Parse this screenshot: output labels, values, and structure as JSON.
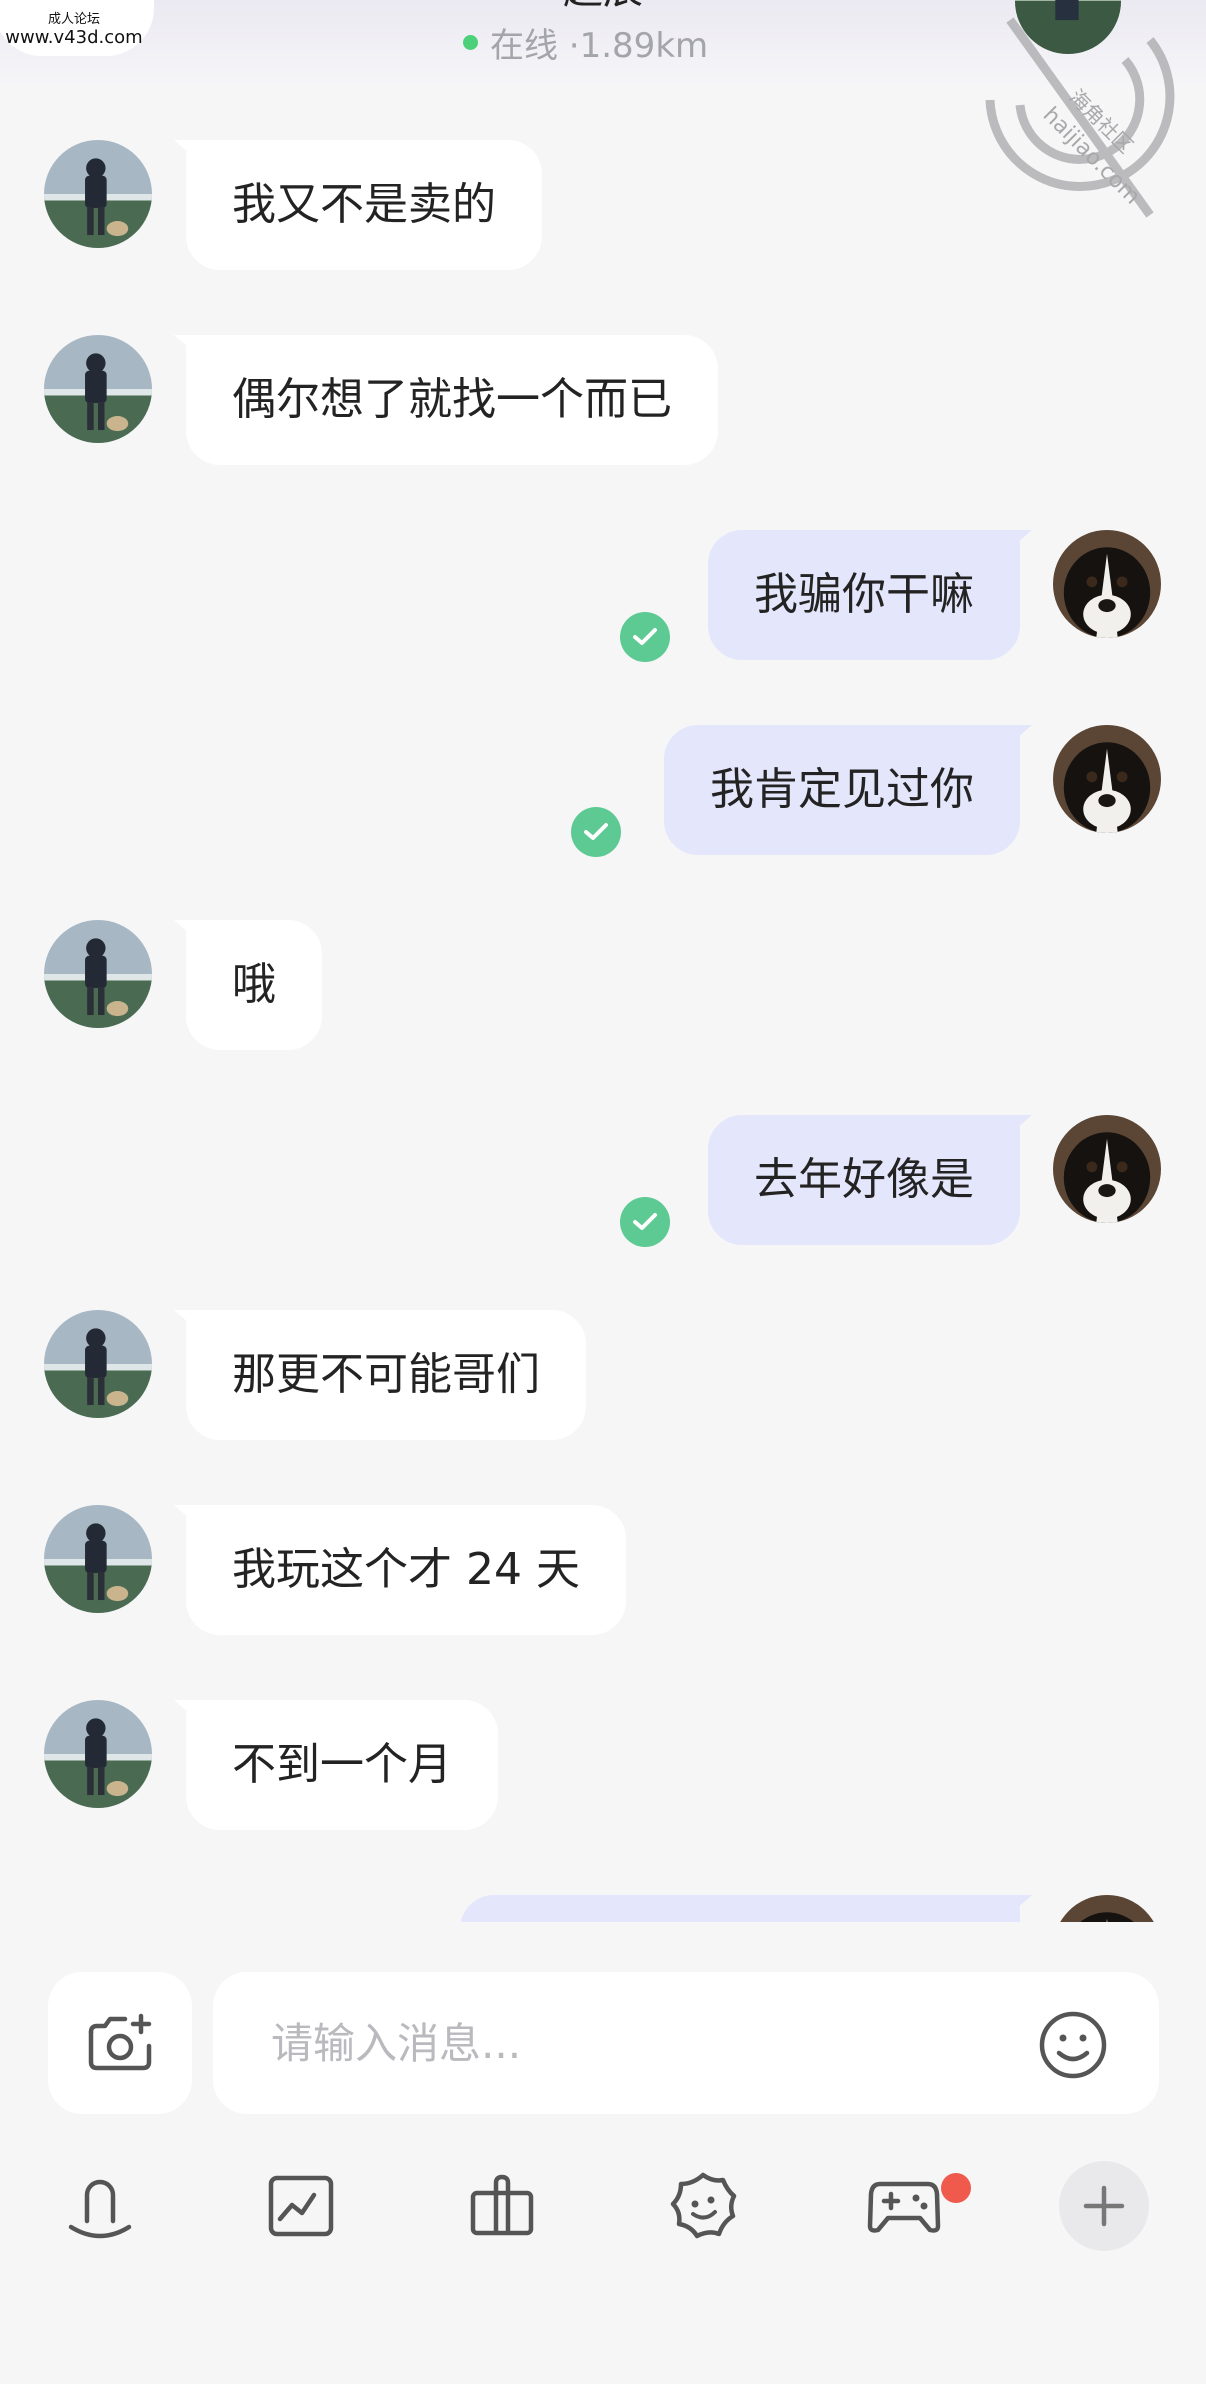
{
  "header": {
    "title": "超辰",
    "status": "在线 ·1.89km",
    "site_badge": {
      "cn": "成人论坛",
      "en": "www.v43d.com"
    },
    "watermark": {
      "cn": "海角社区",
      "en": "haijiao.com"
    }
  },
  "messages": [
    {
      "side": "in",
      "text": "我又不是卖的"
    },
    {
      "side": "in",
      "text": "偶尔想了就找一个而已"
    },
    {
      "side": "out",
      "text": "我骗你干嘛",
      "read": true
    },
    {
      "side": "out",
      "text": "我肯定见过你",
      "read": true
    },
    {
      "side": "in",
      "text": "哦"
    },
    {
      "side": "out",
      "text": "去年好像是",
      "read": true
    },
    {
      "side": "in",
      "text": "那更不可能哥们"
    },
    {
      "side": "in",
      "text": "我玩这个才 24 天"
    },
    {
      "side": "in",
      "text": "不到一个月"
    },
    {
      "side": "out",
      "text": "",
      "partial": true
    }
  ],
  "input": {
    "placeholder": "请输入消息..."
  },
  "toolbar": {
    "items": [
      "voice-icon",
      "image-icon",
      "gift-icon",
      "sticker-icon",
      "game-icon",
      "plus-icon"
    ],
    "game_has_notification": true
  },
  "colors": {
    "background": "#f6f6f7",
    "incoming_bubble": "#ffffff",
    "outgoing_bubble": "#e4e6fb",
    "read_check": "#5dc993",
    "online_dot": "#4cd17a",
    "notification_dot": "#f05a4d"
  }
}
